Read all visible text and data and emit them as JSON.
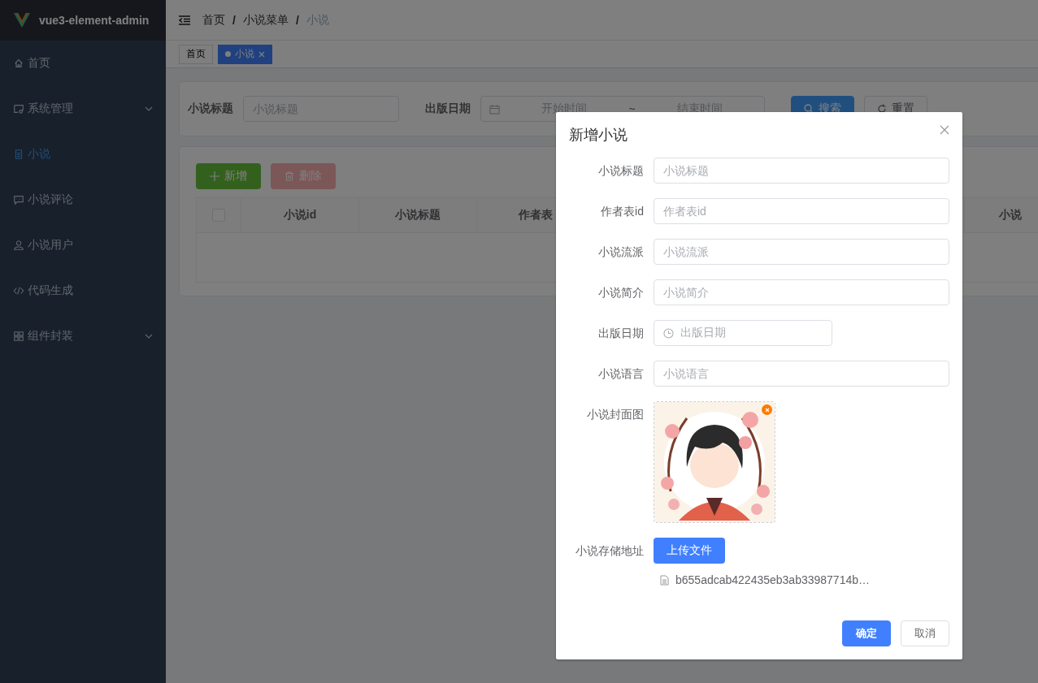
{
  "sidebar": {
    "logo": "vue3-element-admin",
    "items": [
      {
        "label": "首页",
        "selected": false,
        "expandable": false
      },
      {
        "label": "系统管理",
        "selected": false,
        "expandable": true
      },
      {
        "label": "小说",
        "selected": true,
        "expandable": false
      },
      {
        "label": "小说评论",
        "selected": false,
        "expandable": false
      },
      {
        "label": "小说用户",
        "selected": false,
        "expandable": false
      },
      {
        "label": "代码生成",
        "selected": false,
        "expandable": false
      },
      {
        "label": "组件封装",
        "selected": false,
        "expandable": true
      }
    ]
  },
  "navbar": {
    "breadcrumb": [
      "首页",
      "/",
      "小说菜单",
      "/",
      "小说"
    ]
  },
  "tags": [
    {
      "label": "首页",
      "selected": false,
      "closable": false
    },
    {
      "label": "小说",
      "selected": true,
      "closable": true
    }
  ],
  "search_form": {
    "title_label": "小说标题",
    "title_placeholder": "小说标题",
    "date_label": "出版日期",
    "start_placeholder": "开始时间",
    "separator": "~",
    "end_placeholder": "结束时间",
    "buttons": [
      {
        "label": "搜索",
        "kind": "primary"
      },
      {
        "label": "重置",
        "kind": "default"
      }
    ]
  },
  "toolbar": [
    {
      "label": "新增",
      "kind": "add",
      "disabled": false
    },
    {
      "label": "删除",
      "kind": "delete",
      "disabled": true
    }
  ],
  "table": {
    "select_all_checked": false,
    "columns": [
      "小说id",
      "小说标题",
      "作者表",
      "小说"
    ]
  },
  "dialog": {
    "title": "新增小说",
    "fields": [
      {
        "label": "小说标题",
        "kind": "text",
        "placeholder": "小说标题"
      },
      {
        "label": "作者表id",
        "kind": "text",
        "placeholder": "作者表id"
      },
      {
        "label": "小说流派",
        "kind": "text",
        "placeholder": "小说流派"
      },
      {
        "label": "小说简介",
        "kind": "text",
        "placeholder": "小说简介"
      },
      {
        "label": "出版日期",
        "kind": "date",
        "placeholder": "出版日期"
      },
      {
        "label": "小说语言",
        "kind": "text",
        "placeholder": "小说语言"
      },
      {
        "label": "小说封面图"
      },
      {
        "label": "小说存储地址",
        "kind": "upload",
        "button": "上传文件",
        "files": [
          "b655adcab422435eb3ab33987714b…"
        ]
      }
    ],
    "buttons": [
      {
        "label": "确定",
        "kind": "primary"
      },
      {
        "label": "取消",
        "kind": "default"
      }
    ]
  }
}
